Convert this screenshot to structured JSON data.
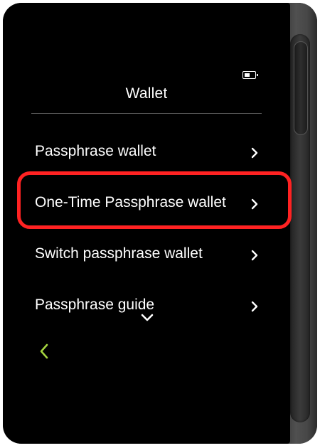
{
  "header": {
    "title": "Wallet",
    "battery_icon": "battery-icon",
    "battery_level": 0.6
  },
  "menu": {
    "items": [
      {
        "label": "Passphrase wallet",
        "icon": "chevron-right-icon"
      },
      {
        "label": "One-Time Passphrase wallet",
        "icon": "chevron-right-icon"
      },
      {
        "label": "Switch passphrase wallet",
        "icon": "chevron-right-icon"
      },
      {
        "label": "Passphrase guide",
        "icon": "chevron-right-icon"
      }
    ]
  },
  "footer": {
    "more_icon": "chevron-down-icon",
    "back_icon": "back-arrow-icon"
  },
  "colors": {
    "screen_bg": "#000000",
    "text": "#ffffff",
    "accent_back": "#a4d43f",
    "highlight_border": "#ff2222"
  }
}
